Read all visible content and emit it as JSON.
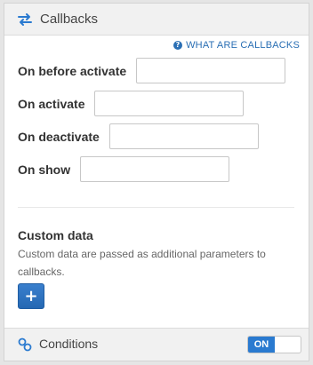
{
  "header": {
    "title": "Callbacks",
    "icon": "swap-arrows-icon"
  },
  "help_link": {
    "label": "WHAT ARE CALLBACKS",
    "icon": "question-circle-icon"
  },
  "callbacks": [
    {
      "label": "On before activate",
      "value": ""
    },
    {
      "label": "On activate",
      "value": ""
    },
    {
      "label": "On deactivate",
      "value": ""
    },
    {
      "label": "On show",
      "value": ""
    }
  ],
  "custom_data": {
    "title": "Custom data",
    "description": "Custom data are passed as additional parameters to callbacks.",
    "add_button_label": "+"
  },
  "footer": {
    "title": "Conditions",
    "icon": "link-icon",
    "toggle_label": "ON",
    "toggle_on": true
  },
  "colors": {
    "accent": "#2a7ad0",
    "link": "#2a6fb4",
    "header_bg": "#f1f1f1"
  }
}
